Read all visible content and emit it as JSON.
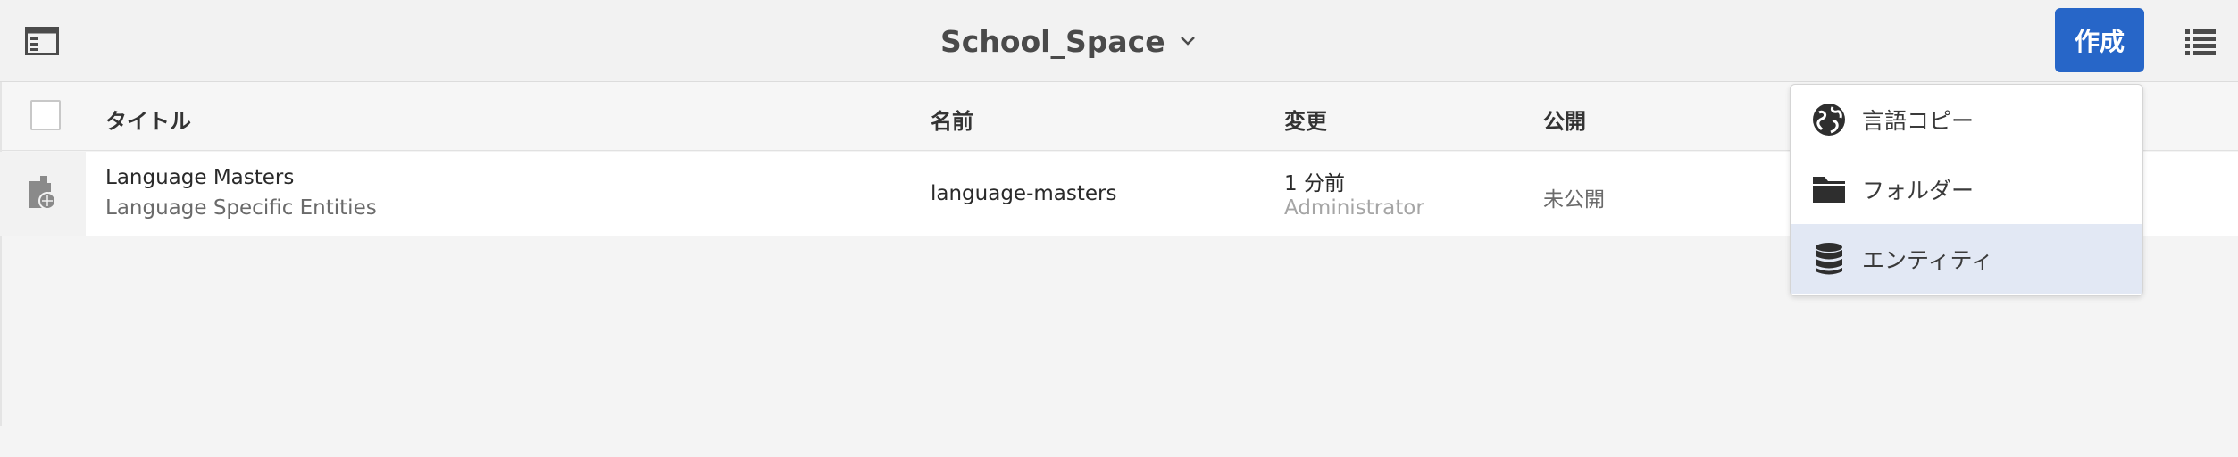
{
  "header": {
    "title": "School_Space",
    "create_label": "作成"
  },
  "table": {
    "columns": [
      "タイトル",
      "名前",
      "変更",
      "公開"
    ],
    "rows": [
      {
        "title": "Language Masters",
        "subtitle": "Language Specific Entities",
        "name": "language-masters",
        "modified_time": "1 分前",
        "modified_by": "Administrator",
        "published": "未公開"
      }
    ]
  },
  "create_menu": {
    "items": [
      {
        "label": "言語コピー",
        "icon": "globe-icon"
      },
      {
        "label": "フォルダー",
        "icon": "folder-icon"
      },
      {
        "label": "エンティティ",
        "icon": "database-icon"
      }
    ],
    "highlighted_index": 2
  },
  "colors": {
    "accent": "#2766c8",
    "highlight": "#e2e8f4"
  }
}
